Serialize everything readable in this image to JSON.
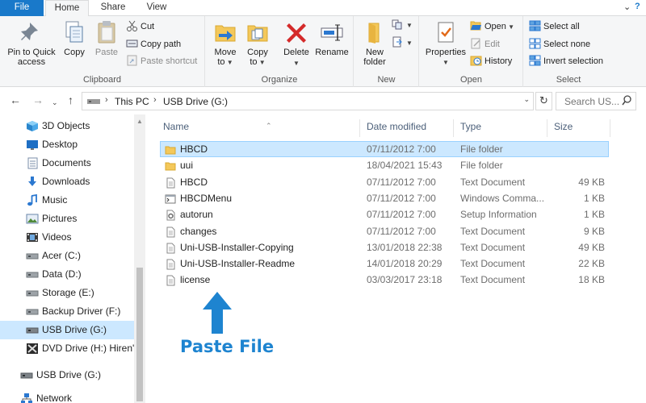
{
  "tabs": [
    "File",
    "Home",
    "Share",
    "View"
  ],
  "ribbon": {
    "clipboard": {
      "pin": "Pin to Quick\naccess",
      "copy": "Copy",
      "paste": "Paste",
      "cut": "Cut",
      "copy_path": "Copy path",
      "paste_shortcut": "Paste shortcut",
      "label": "Clipboard"
    },
    "organize": {
      "move_to": "Move\nto",
      "copy_to": "Copy\nto",
      "delete": "Delete",
      "rename": "Rename",
      "label": "Organize"
    },
    "new": {
      "new_folder": "New\nfolder",
      "label": "New"
    },
    "open": {
      "properties": "Properties",
      "open": "Open",
      "edit": "Edit",
      "history": "History",
      "label": "Open"
    },
    "select": {
      "select_all": "Select all",
      "select_none": "Select none",
      "invert": "Invert selection",
      "label": "Select"
    }
  },
  "address": {
    "crumbs": [
      "This PC",
      "USB Drive (G:)"
    ],
    "search_placeholder": "Search US..."
  },
  "nav": {
    "items": [
      {
        "label": "3D Objects",
        "icon": "3d-objects-icon"
      },
      {
        "label": "Desktop",
        "icon": "desktop-icon"
      },
      {
        "label": "Documents",
        "icon": "documents-icon"
      },
      {
        "label": "Downloads",
        "icon": "downloads-icon"
      },
      {
        "label": "Music",
        "icon": "music-icon"
      },
      {
        "label": "Pictures",
        "icon": "pictures-icon"
      },
      {
        "label": "Videos",
        "icon": "videos-icon"
      },
      {
        "label": "Acer (C:)",
        "icon": "drive-icon"
      },
      {
        "label": "Data (D:)",
        "icon": "drive-icon"
      },
      {
        "label": "Storage (E:)",
        "icon": "drive-icon"
      },
      {
        "label": "Backup Driver (F:)",
        "icon": "drive-icon"
      },
      {
        "label": "USB Drive (G:)",
        "icon": "usb-drive-icon",
        "selected": true
      },
      {
        "label": "DVD Drive (H:) Hiren's",
        "icon": "dvd-drive-icon"
      },
      {
        "label": "USB Drive (G:)",
        "icon": "usb-drive-icon",
        "top_level": true
      },
      {
        "label": "Network",
        "icon": "network-icon",
        "top_level": true
      }
    ]
  },
  "columns": {
    "name": "Name",
    "date": "Date modified",
    "type": "Type",
    "size": "Size"
  },
  "files": [
    {
      "name": "HBCD",
      "date": "07/11/2012 7:00",
      "type": "File folder",
      "size": "",
      "icon": "folder-icon",
      "selected": true
    },
    {
      "name": "uui",
      "date": "18/04/2021 15:43",
      "type": "File folder",
      "size": "",
      "icon": "folder-icon"
    },
    {
      "name": "HBCD",
      "date": "07/11/2012 7:00",
      "type": "Text Document",
      "size": "49 KB",
      "icon": "text-file-icon"
    },
    {
      "name": "HBCDMenu",
      "date": "07/11/2012 7:00",
      "type": "Windows Comma...",
      "size": "1 KB",
      "icon": "cmd-file-icon"
    },
    {
      "name": "autorun",
      "date": "07/11/2012 7:00",
      "type": "Setup Information",
      "size": "1 KB",
      "icon": "setup-file-icon"
    },
    {
      "name": "changes",
      "date": "07/11/2012 7:00",
      "type": "Text Document",
      "size": "9 KB",
      "icon": "text-file-icon"
    },
    {
      "name": "Uni-USB-Installer-Copying",
      "date": "13/01/2018 22:38",
      "type": "Text Document",
      "size": "49 KB",
      "icon": "text-file-icon"
    },
    {
      "name": "Uni-USB-Installer-Readme",
      "date": "14/01/2018 20:29",
      "type": "Text Document",
      "size": "22 KB",
      "icon": "text-file-icon"
    },
    {
      "name": "license",
      "date": "03/03/2017 23:18",
      "type": "Text Document",
      "size": "18 KB",
      "icon": "text-file-icon"
    }
  ],
  "annotation": {
    "text": "Paste File"
  },
  "colors": {
    "file_tab": "#1979ca",
    "selection": "#cce8ff",
    "selection_border": "#99d1ff",
    "annotation": "#1e84d0"
  }
}
